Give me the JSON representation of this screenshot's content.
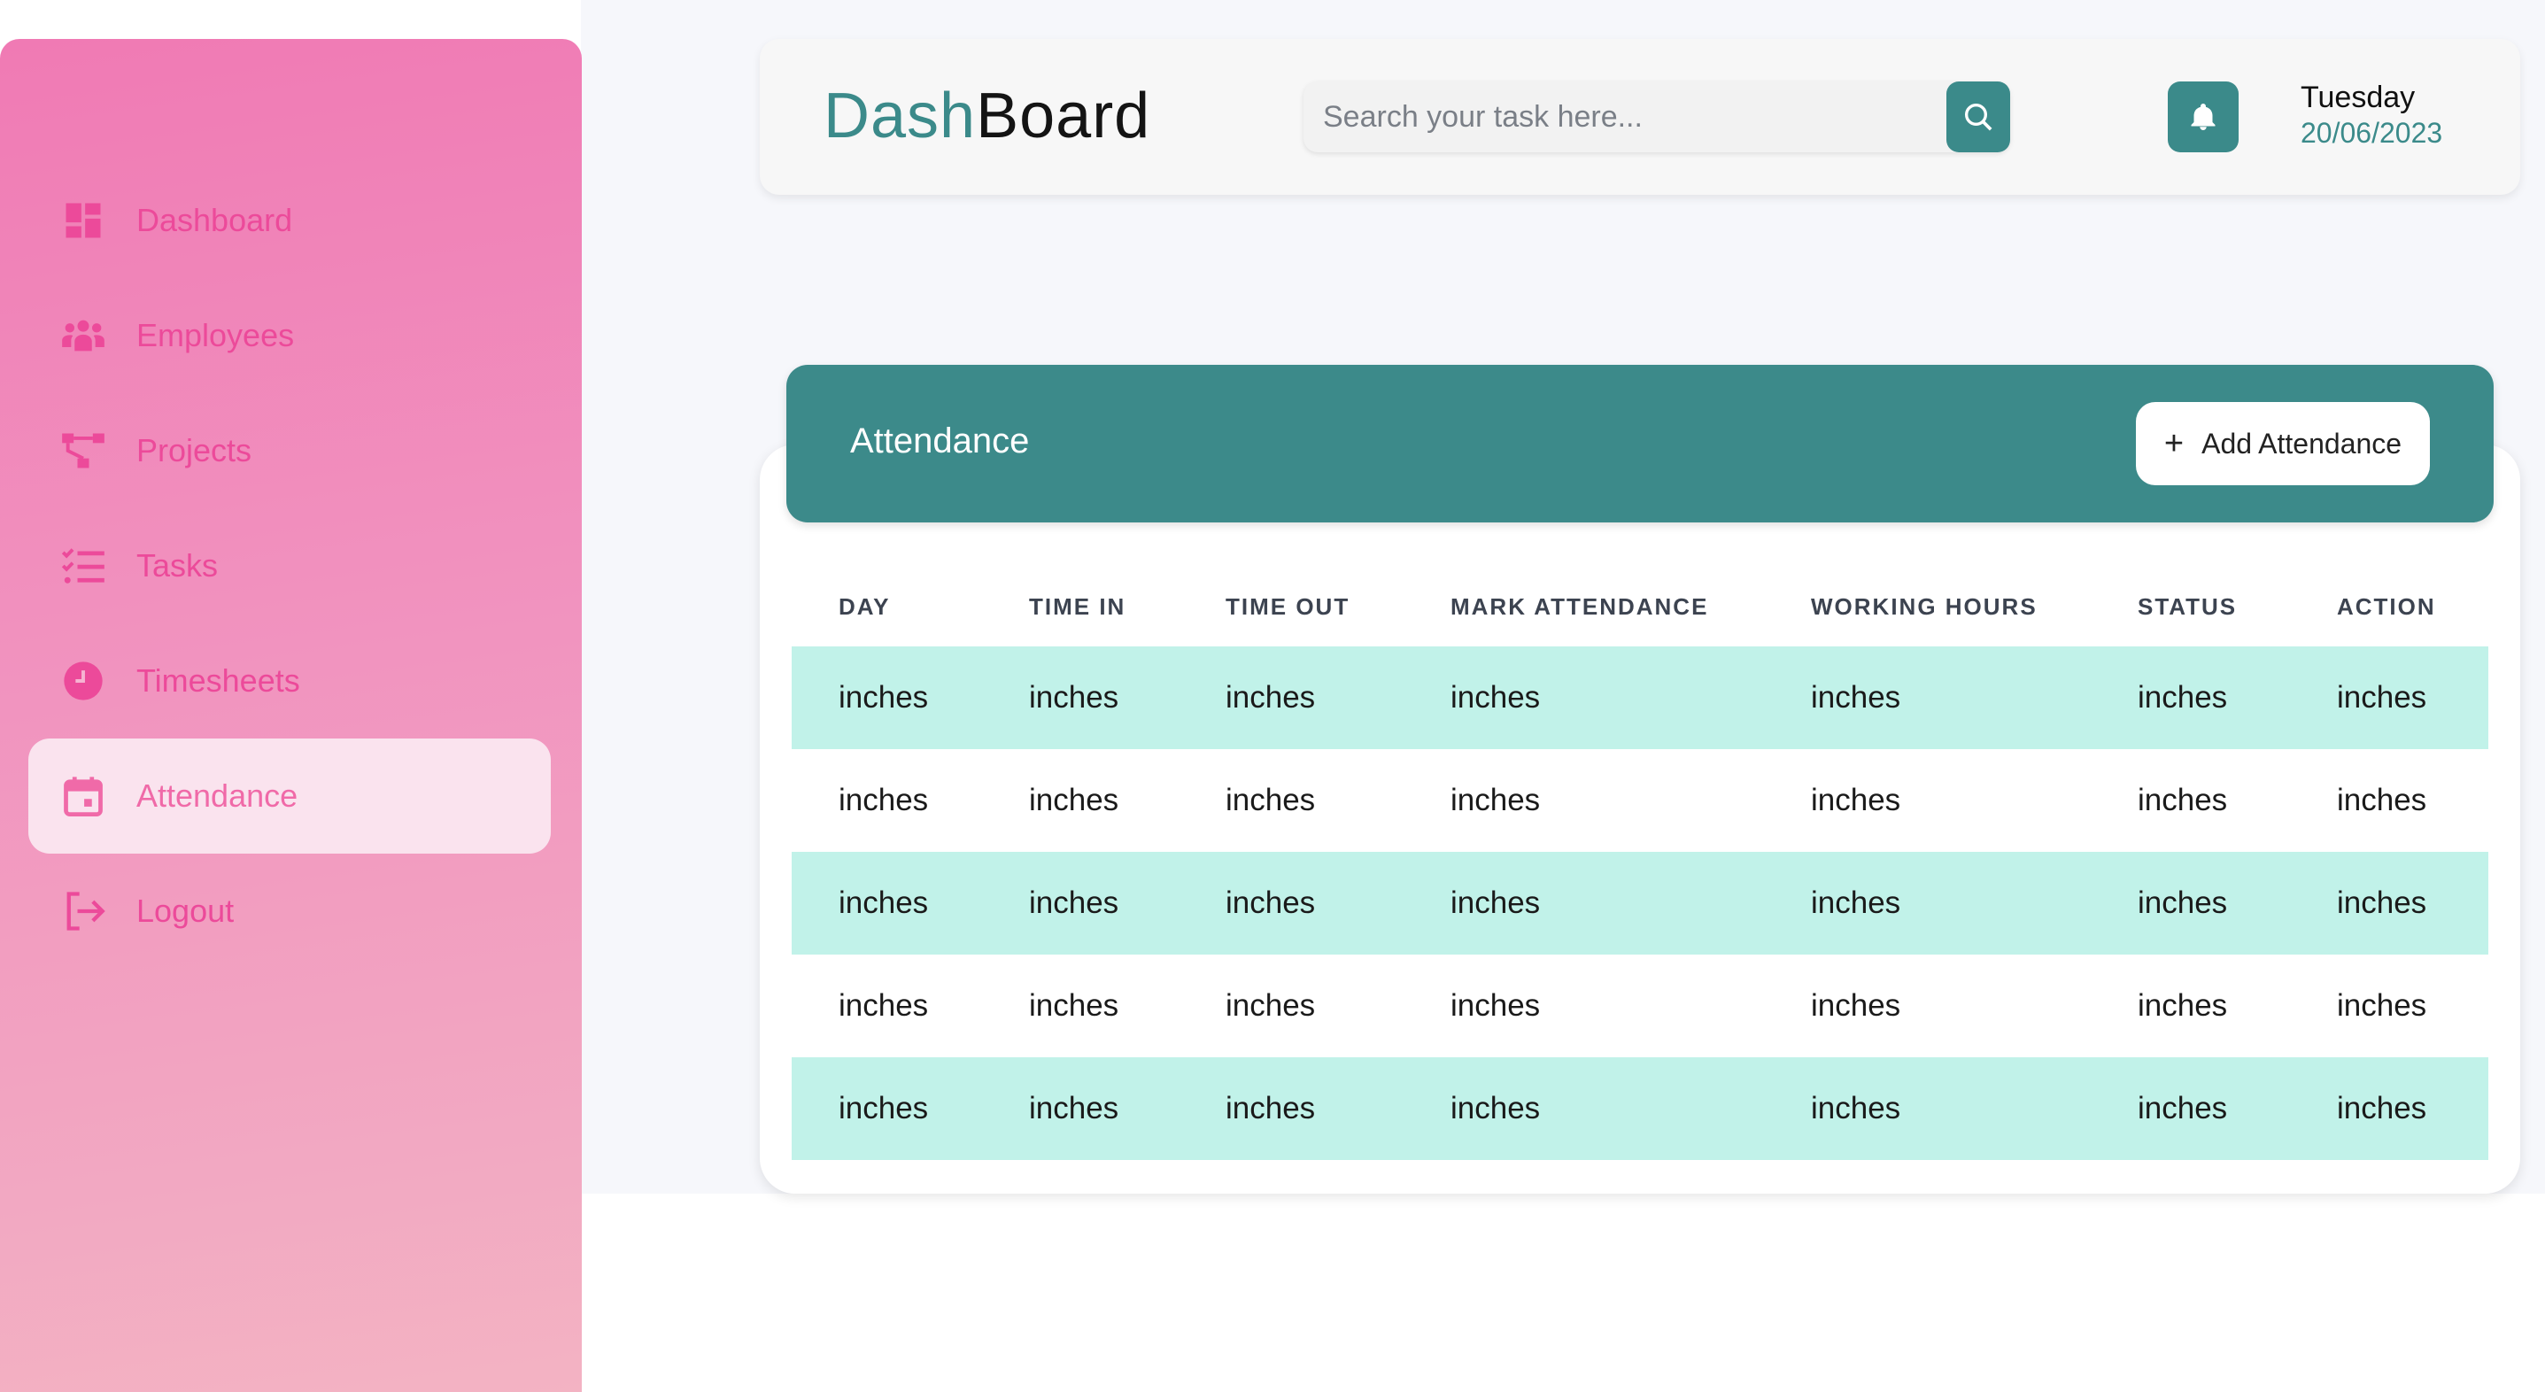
{
  "sidebar": {
    "items": [
      {
        "label": "Dashboard",
        "icon": "dashboard-icon",
        "active": false
      },
      {
        "label": "Employees",
        "icon": "employees-icon",
        "active": false
      },
      {
        "label": "Projects",
        "icon": "projects-icon",
        "active": false
      },
      {
        "label": "Tasks",
        "icon": "tasks-icon",
        "active": false
      },
      {
        "label": "Timesheets",
        "icon": "clock-icon",
        "active": false
      },
      {
        "label": "Attendance",
        "icon": "calendar-icon",
        "active": true
      },
      {
        "label": "Logout",
        "icon": "logout-icon",
        "active": false
      }
    ]
  },
  "header": {
    "brand_part1": "Dash",
    "brand_part2": "Board",
    "search_placeholder": "Search your task here...",
    "day": "Tuesday",
    "date": "20/06/2023"
  },
  "attendance": {
    "title": "Attendance",
    "add_plus": "+",
    "add_label": "Add Attendance",
    "columns": [
      "DAY",
      "TIME IN",
      "TIME OUT",
      "MARK ATTENDANCE",
      "WORKING HOURS",
      "STATUS",
      "ACTION"
    ],
    "rows": [
      [
        "inches",
        "inches",
        "inches",
        "inches",
        "inches",
        "inches",
        "inches"
      ],
      [
        "inches",
        "inches",
        "inches",
        "inches",
        "inches",
        "inches",
        "inches"
      ],
      [
        "inches",
        "inches",
        "inches",
        "inches",
        "inches",
        "inches",
        "inches"
      ],
      [
        "inches",
        "inches",
        "inches",
        "inches",
        "inches",
        "inches",
        "inches"
      ],
      [
        "inches",
        "inches",
        "inches",
        "inches",
        "inches",
        "inches",
        "inches"
      ]
    ]
  },
  "colors": {
    "teal": "#3b8a8a",
    "pink": "#ec4a9a",
    "stripe": "#c1f2e9"
  }
}
